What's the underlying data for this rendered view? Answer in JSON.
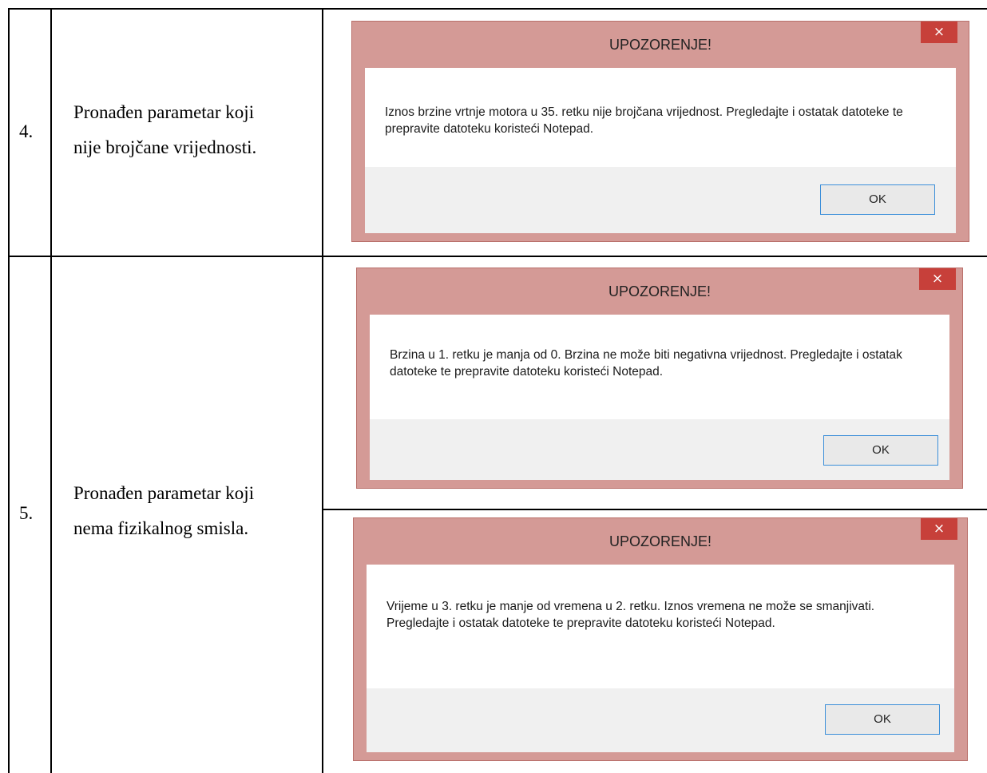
{
  "rows": [
    {
      "number": "4.",
      "description_line1": "Pronađen parametar koji",
      "description_line2": "nije brojčane vrijednosti.",
      "dialogs": [
        {
          "title": "UPOZORENJE!",
          "close_glyph": "×",
          "message": "Iznos brzine vrtnje motora u 35. retku nije brojčana vrijednost. Pregledajte i ostatak datoteke te prepravite datoteku koristeći Notepad.",
          "ok_label": "OK"
        }
      ]
    },
    {
      "number": "5.",
      "description_line1": "Pronađen parametar koji",
      "description_line2": "nema fizikalnog smisla.",
      "dialogs": [
        {
          "title": "UPOZORENJE!",
          "close_glyph": "×",
          "message": "Brzina u 1. retku je manja od 0. Brzina ne može biti negativna vrijednost. Pregledajte i ostatak datoteke te prepravite datoteku koristeći Notepad.",
          "ok_label": "OK"
        },
        {
          "title": "UPOZORENJE!",
          "close_glyph": "×",
          "message": "Vrijeme u 3. retku je manje od vremena u 2. retku. Iznos vremena ne može se smanjivati. Pregledajte i ostatak datoteke te prepravite datoteku koristeći Notepad.",
          "ok_label": "OK"
        }
      ]
    }
  ]
}
